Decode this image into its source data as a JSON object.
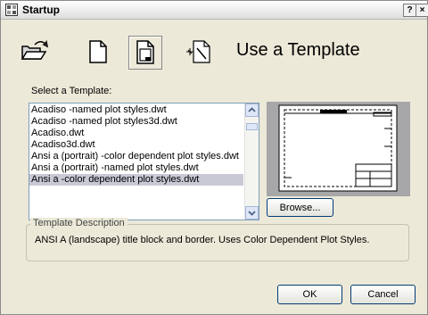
{
  "window": {
    "title": "Startup",
    "help_label": "?",
    "close_label": "×"
  },
  "mode_toolbar": {
    "icons": [
      "open-drawing-icon",
      "start-from-scratch-icon",
      "use-template-icon",
      "setup-wizard-icon"
    ],
    "selected_index": 2
  },
  "heading": "Use a Template",
  "template_list": {
    "label": "Select a Template:",
    "items": [
      "Acadiso -named plot styles.dwt",
      "Acadiso -named plot styles3d.dwt",
      "Acadiso.dwt",
      "Acadiso3d.dwt",
      "Ansi a (portrait) -color dependent plot styles.dwt",
      "Ansi a (portrait) -named plot styles.dwt",
      "Ansi a -color dependent plot styles.dwt"
    ],
    "selected_index": 6
  },
  "browse_label": "Browse...",
  "description": {
    "legend": "Template Description",
    "text": "ANSI A (landscape) title block and border.  Uses Color Dependent Plot Styles."
  },
  "buttons": {
    "ok": "OK",
    "cancel": "Cancel"
  },
  "colors": {
    "dialog_bg": "#ece9d8",
    "selection_bg": "#c9c9d6",
    "preview_bg": "#a7a6a8"
  }
}
